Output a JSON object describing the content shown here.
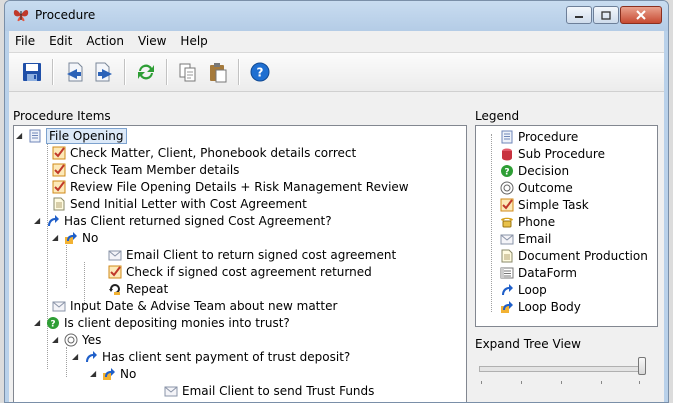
{
  "window": {
    "title": "Procedure",
    "icon": "butterfly-icon",
    "controls": [
      "minimize",
      "maximize",
      "close"
    ]
  },
  "menu": [
    "File",
    "Edit",
    "Action",
    "View",
    "Help"
  ],
  "toolbar": [
    "save-icon",
    "import-icon",
    "export-icon",
    "refresh-icon",
    "copy-icon",
    "paste-icon",
    "help-icon"
  ],
  "tree": {
    "label": "Procedure Items",
    "items": [
      {
        "text": "File Opening",
        "icon": "procedure-icon",
        "level": 0,
        "expanded": true,
        "selected": true
      },
      {
        "text": "Check Matter, Client, Phonebook details correct",
        "icon": "simple-task-icon",
        "level": 1
      },
      {
        "text": "Check Team Member details",
        "icon": "simple-task-icon",
        "level": 1
      },
      {
        "text": "Review File Opening Details + Risk Management Review",
        "icon": "simple-task-icon",
        "level": 1
      },
      {
        "text": "Send Initial Letter with Cost Agreement",
        "icon": "document-production-icon",
        "level": 1
      },
      {
        "text": "Has Client returned signed Cost Agreement?",
        "icon": "loop-icon",
        "level": 1,
        "expanded": true
      },
      {
        "text": "No",
        "icon": "loop-body-icon",
        "level": 2,
        "expanded": true
      },
      {
        "text": "Email Client to return signed cost agreement",
        "icon": "email-icon",
        "level": 3
      },
      {
        "text": "Check if signed cost agreement returned",
        "icon": "simple-task-icon",
        "level": 3
      },
      {
        "text": "Repeat",
        "icon": "repeat-icon",
        "level": 3
      },
      {
        "text": "Input Date & Advise Team about new matter",
        "icon": "email-icon",
        "level": 1
      },
      {
        "text": "Is client depositing monies into trust?",
        "icon": "decision-icon",
        "level": 1,
        "expanded": true
      },
      {
        "text": "Yes",
        "icon": "outcome-icon",
        "level": 2,
        "expanded": true
      },
      {
        "text": "Has client sent payment of trust deposit?",
        "icon": "loop-icon",
        "level": 3,
        "expanded": true
      },
      {
        "text": "No",
        "icon": "loop-body-icon",
        "level": 4,
        "expanded": true
      },
      {
        "text": "Email Client to send Trust Funds",
        "icon": "email-icon",
        "level": 5
      }
    ]
  },
  "legend": {
    "label": "Legend",
    "items": [
      {
        "text": "Procedure",
        "icon": "procedure-icon"
      },
      {
        "text": "Sub Procedure",
        "icon": "sub-procedure-icon"
      },
      {
        "text": "Decision",
        "icon": "decision-icon"
      },
      {
        "text": "Outcome",
        "icon": "outcome-icon"
      },
      {
        "text": "Simple Task",
        "icon": "simple-task-icon"
      },
      {
        "text": "Phone",
        "icon": "phone-icon"
      },
      {
        "text": "Email",
        "icon": "email-icon"
      },
      {
        "text": "Document Production",
        "icon": "document-production-icon"
      },
      {
        "text": "DataForm",
        "icon": "dataform-icon"
      },
      {
        "text": "Loop",
        "icon": "loop-icon"
      },
      {
        "text": "Loop Body",
        "icon": "loop-body-icon"
      }
    ]
  },
  "expand": {
    "label": "Expand Tree View",
    "level": 1.0
  },
  "colors": {
    "titlebar": "#c8dcf0",
    "accent": "#1f6fd1",
    "close": "#c74a32"
  }
}
